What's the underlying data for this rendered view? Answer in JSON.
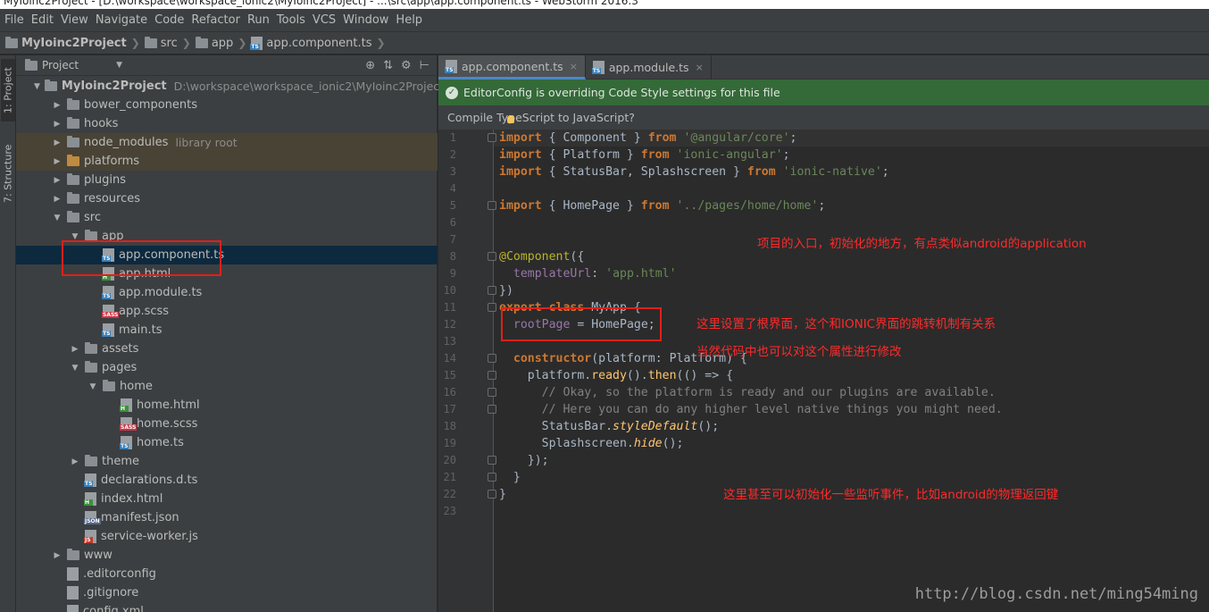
{
  "window": {
    "title": "MyIoinc2Project - [D:\\workspace\\workspace_ionic2\\MyIoinc2Project] - ...\\src\\app\\app.component.ts - WebStorm 2016.3"
  },
  "menu": [
    "File",
    "Edit",
    "View",
    "Navigate",
    "Code",
    "Refactor",
    "Run",
    "Tools",
    "VCS",
    "Window",
    "Help"
  ],
  "breadcrumb": [
    "MyIoinc2Project",
    "src",
    "app",
    "app.component.ts"
  ],
  "side_tabs": {
    "project": "1: Project",
    "structure": "7: Structure"
  },
  "project_panel": {
    "view_label": "Project",
    "tree": [
      {
        "name": "MyIoinc2Project",
        "extra": "D:\\workspace\\workspace_ionic2\\MyIoinc2Project",
        "kind": "folder"
      },
      {
        "name": "bower_components",
        "kind": "folder"
      },
      {
        "name": "hooks",
        "kind": "folder"
      },
      {
        "name": "node_modules",
        "extra": "library root",
        "kind": "folder"
      },
      {
        "name": "platforms",
        "kind": "folder-orange"
      },
      {
        "name": "plugins",
        "kind": "folder"
      },
      {
        "name": "resources",
        "kind": "folder"
      },
      {
        "name": "src",
        "kind": "folder"
      },
      {
        "name": "app",
        "kind": "folder"
      },
      {
        "name": "app.component.ts",
        "kind": "file",
        "tag": "TS"
      },
      {
        "name": "app.html",
        "kind": "file",
        "tag": "H"
      },
      {
        "name": "app.module.ts",
        "kind": "file",
        "tag": "TS"
      },
      {
        "name": "app.scss",
        "kind": "file",
        "tag": "SASS"
      },
      {
        "name": "main.ts",
        "kind": "file",
        "tag": "TS"
      },
      {
        "name": "assets",
        "kind": "folder"
      },
      {
        "name": "pages",
        "kind": "folder"
      },
      {
        "name": "home",
        "kind": "folder"
      },
      {
        "name": "home.html",
        "kind": "file",
        "tag": "H"
      },
      {
        "name": "home.scss",
        "kind": "file",
        "tag": "SASS"
      },
      {
        "name": "home.ts",
        "kind": "file",
        "tag": "TS"
      },
      {
        "name": "theme",
        "kind": "folder"
      },
      {
        "name": "declarations.d.ts",
        "kind": "file",
        "tag": "TS"
      },
      {
        "name": "index.html",
        "kind": "file",
        "tag": "H"
      },
      {
        "name": "manifest.json",
        "kind": "file",
        "tag": "JSON"
      },
      {
        "name": "service-worker.js",
        "kind": "file",
        "tag": "JS"
      },
      {
        "name": "www",
        "kind": "folder"
      },
      {
        "name": ".editorconfig",
        "kind": "file"
      },
      {
        "name": ".gitignore",
        "kind": "file"
      },
      {
        "name": "config.xml",
        "kind": "file"
      }
    ]
  },
  "editor": {
    "tabs": [
      {
        "label": "app.component.ts",
        "close": "×"
      },
      {
        "label": "app.module.ts",
        "close": "×"
      }
    ],
    "editorconfig_banner": "EditorConfig is overriding Code Style settings for this file",
    "compile_prompt": "Compile TypeScript to JavaScript?",
    "line_numbers": [
      "1",
      "2",
      "3",
      "4",
      "5",
      "6",
      "7",
      "8",
      "9",
      "10",
      "11",
      "12",
      "13",
      "14",
      "15",
      "16",
      "17",
      "18",
      "19",
      "20",
      "21",
      "22",
      "23"
    ]
  },
  "annotations": {
    "note1": "项目的入口，初始化的地方，有点类似android的application",
    "note2": "这里设置了根界面，这个和IONIC界面的跳转机制有关系",
    "note3": "当然代码中也可以对这个属性进行修改",
    "note4": "这里甚至可以初始化一些监听事件，比如android的物理返回键"
  },
  "watermark": "http://blog.csdn.net/ming54ming",
  "colors": {
    "keyword": "#cc7832",
    "string": "#6a8759",
    "comment": "#808080",
    "annotation_red": "#ff2a2a",
    "banner_green": "#346938"
  }
}
